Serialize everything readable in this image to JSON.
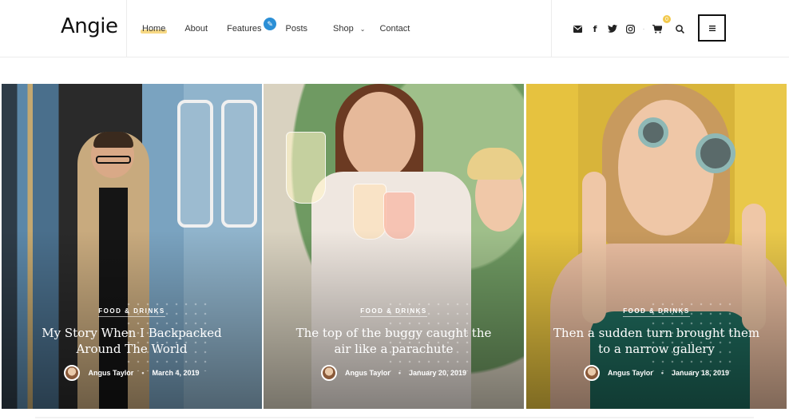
{
  "brand": {
    "logo": "Angie"
  },
  "nav": {
    "items": [
      {
        "label": "Home",
        "active": true
      },
      {
        "label": "About"
      },
      {
        "label": "Features"
      },
      {
        "label": "Posts"
      },
      {
        "label": "Shop"
      },
      {
        "label": "Contact"
      }
    ],
    "features_badge_icon": "pencil-icon",
    "shop_dropdown_icon": "chevron-down-icon"
  },
  "header_actions": {
    "icons": [
      "mail-icon",
      "facebook-icon",
      "twitter-icon",
      "instagram-icon",
      "cart-icon",
      "search-icon"
    ],
    "cart_count": "0",
    "menu_icon": "hamburger-menu-icon"
  },
  "cards": [
    {
      "category": "FOOD & DRINKS",
      "title": "My Story When I Backpacked Around The World",
      "author": "Angus Taylor",
      "date": "March 4, 2019"
    },
    {
      "category": "FOOD & DRINKS",
      "title": "The top of the buggy caught the air like a parachute",
      "author": "Angus Taylor",
      "date": "January 20, 2019"
    },
    {
      "category": "FOOD & DRINKS",
      "title": "Then a sudden turn brought them to a narrow gallery",
      "author": "Angus Taylor",
      "date": "January 18, 2019"
    }
  ],
  "colors": {
    "accent_highlight": "#f7d985",
    "badge_blue": "#2b8fd6",
    "cart_badge": "#f2c94c"
  }
}
